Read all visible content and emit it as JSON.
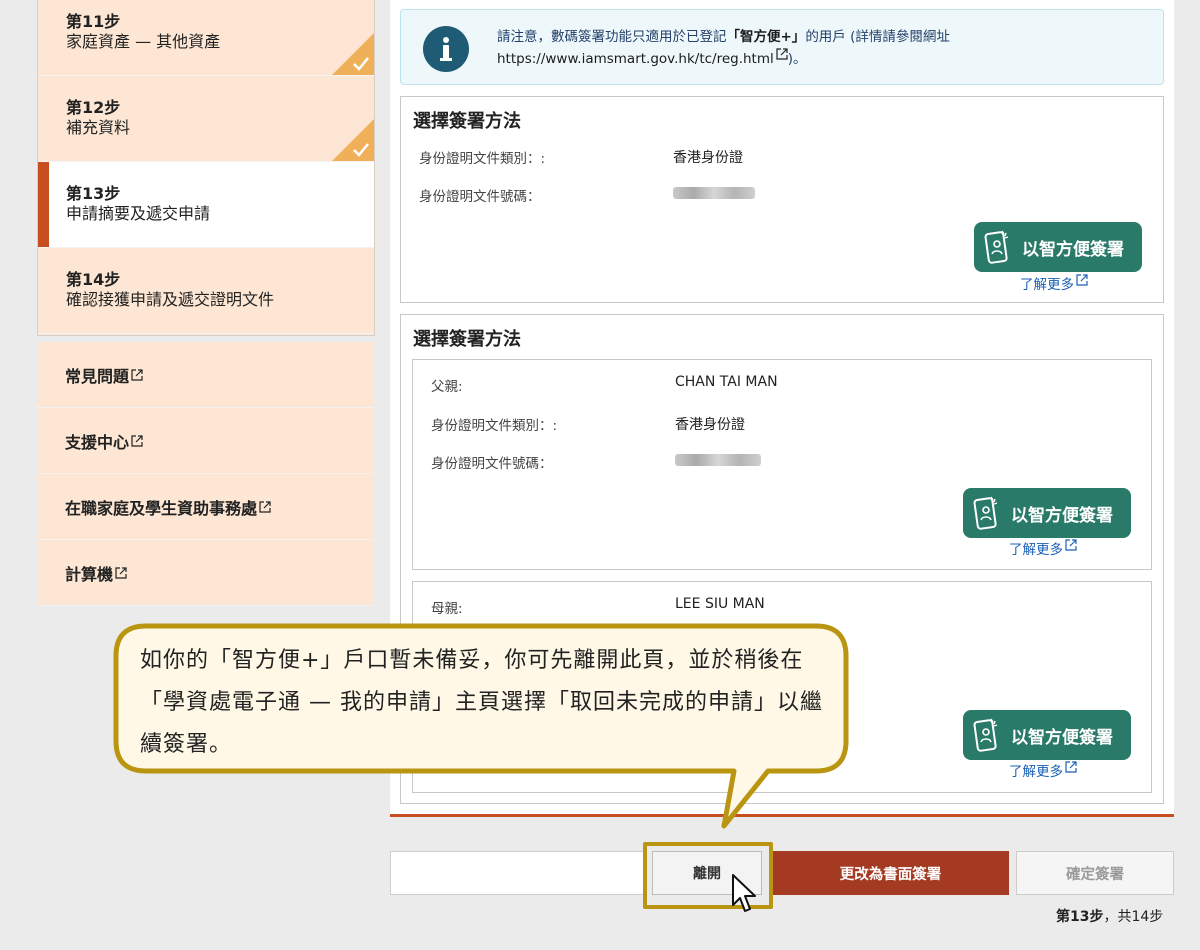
{
  "sidebar": {
    "steps": [
      {
        "num": "第11步",
        "name": "家庭資產 — 其他資產",
        "state": "done"
      },
      {
        "num": "第12步",
        "name": "補充資料",
        "state": "done"
      },
      {
        "num": "第13步",
        "name": "申請摘要及遞交申請",
        "state": "current"
      },
      {
        "num": "第14步",
        "name": "確認接獲申請及遞交證明文件",
        "state": "pending"
      }
    ],
    "links": [
      {
        "label": "常見問題"
      },
      {
        "label": "支援中心"
      },
      {
        "label": "在職家庭及學生資助事務處"
      },
      {
        "label": "計算機"
      }
    ]
  },
  "notice": {
    "text_before": "請注意，數碼簽署功能只適用於已登記",
    "highlight": "「智方便+」",
    "text_after": "的用戶 (詳情請參閱網址",
    "url": "https://www.iamsmart.gov.hk/tc/reg.html",
    "text_end": ")。"
  },
  "cards": {
    "applicant": {
      "title": "選擇簽署方法",
      "doc_type_label": "身份證明文件類別：:",
      "doc_type_value": "香港身份證",
      "doc_no_label": "身份證明文件號碼："
    },
    "parents": {
      "title": "選擇簽署方法",
      "father": {
        "role_label": "父親:",
        "name": "CHAN TAI MAN",
        "doc_type_label": "身份證明文件類別：:",
        "doc_type_value": "香港身份證",
        "doc_no_label": "身份證明文件號碼："
      },
      "mother": {
        "role_label": "母親:",
        "name": "LEE SIU MAN"
      }
    }
  },
  "iamsmart": {
    "button_label": "以智方便簽署",
    "learn_more": "了解更多"
  },
  "callout": {
    "text": "如你的「智方便+」戶口暫未備妥，你可先離開此頁，並於稍後在「學資處電子通 — 我的申請」主頁選擇「取回未完成的申請」以繼續簽署。"
  },
  "actions": {
    "leave": "離開",
    "paper_sign": "更改為書面簽署",
    "confirm_sign": "確定簽署"
  },
  "progress": {
    "current": "第13步",
    "total": "共14步",
    "separator": "，"
  },
  "colors": {
    "accent": "#c64e1f",
    "iamsmart_green": "#2a7a6a",
    "paper_button": "#a53a23",
    "sidebar_bg": "#fde7d4",
    "callout_border": "#b99511",
    "callout_bg": "#fff8e6",
    "check_badge": "#f0b05a"
  }
}
